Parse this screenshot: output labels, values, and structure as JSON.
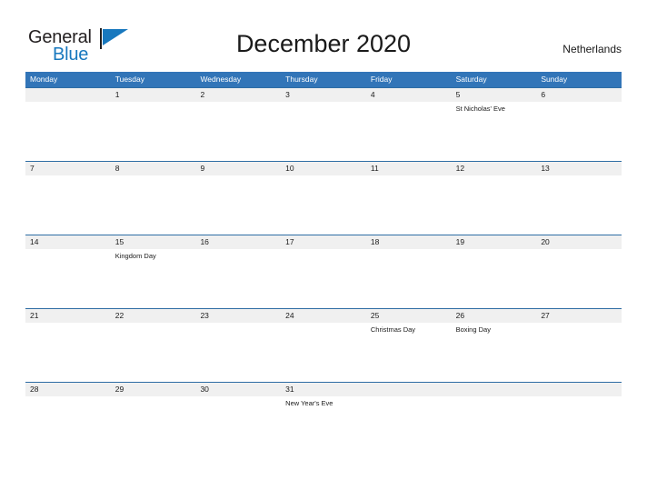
{
  "brand": {
    "name_part1": "General",
    "name_part2": "Blue",
    "accent_color": "#1878be"
  },
  "header": {
    "title": "December 2020",
    "country": "Netherlands",
    "header_bg_color": "#3275b8",
    "row_band_color": "#f0f0f0"
  },
  "calendar": {
    "weekdays": [
      "Monday",
      "Tuesday",
      "Wednesday",
      "Thursday",
      "Friday",
      "Saturday",
      "Sunday"
    ],
    "weeks": [
      {
        "days": [
          {
            "number": "",
            "event": ""
          },
          {
            "number": "1",
            "event": ""
          },
          {
            "number": "2",
            "event": ""
          },
          {
            "number": "3",
            "event": ""
          },
          {
            "number": "4",
            "event": ""
          },
          {
            "number": "5",
            "event": "St Nicholas' Eve"
          },
          {
            "number": "6",
            "event": ""
          }
        ]
      },
      {
        "days": [
          {
            "number": "7",
            "event": ""
          },
          {
            "number": "8",
            "event": ""
          },
          {
            "number": "9",
            "event": ""
          },
          {
            "number": "10",
            "event": ""
          },
          {
            "number": "11",
            "event": ""
          },
          {
            "number": "12",
            "event": ""
          },
          {
            "number": "13",
            "event": ""
          }
        ]
      },
      {
        "days": [
          {
            "number": "14",
            "event": ""
          },
          {
            "number": "15",
            "event": "Kingdom Day"
          },
          {
            "number": "16",
            "event": ""
          },
          {
            "number": "17",
            "event": ""
          },
          {
            "number": "18",
            "event": ""
          },
          {
            "number": "19",
            "event": ""
          },
          {
            "number": "20",
            "event": ""
          }
        ]
      },
      {
        "days": [
          {
            "number": "21",
            "event": ""
          },
          {
            "number": "22",
            "event": ""
          },
          {
            "number": "23",
            "event": ""
          },
          {
            "number": "24",
            "event": ""
          },
          {
            "number": "25",
            "event": "Christmas Day"
          },
          {
            "number": "26",
            "event": "Boxing Day"
          },
          {
            "number": "27",
            "event": ""
          }
        ]
      },
      {
        "days": [
          {
            "number": "28",
            "event": ""
          },
          {
            "number": "29",
            "event": ""
          },
          {
            "number": "30",
            "event": ""
          },
          {
            "number": "31",
            "event": "New Year's Eve"
          },
          {
            "number": "",
            "event": ""
          },
          {
            "number": "",
            "event": ""
          },
          {
            "number": "",
            "event": ""
          }
        ]
      }
    ]
  }
}
